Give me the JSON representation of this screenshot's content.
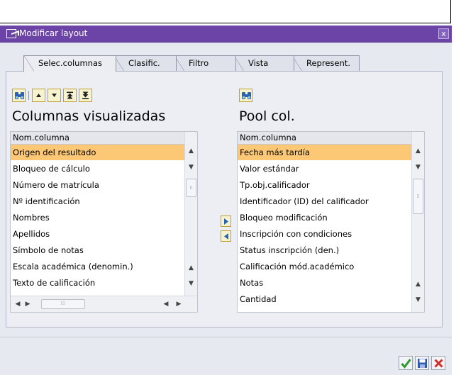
{
  "dialog": {
    "title": "Modificar layout",
    "close_label": "x"
  },
  "tabs": [
    {
      "label": "Selec.columnas",
      "active": true
    },
    {
      "label": "Clasific.",
      "active": false
    },
    {
      "label": "Filtro",
      "active": false
    },
    {
      "label": "Vista",
      "active": false
    },
    {
      "label": "Represent.",
      "active": false
    }
  ],
  "left": {
    "title": "Columnas visualizadas",
    "column_header": "Nom.columna",
    "rows": [
      "Origen del resultado",
      "Bloqueo de cálculo",
      "Número de matrícula",
      "Nº identificación",
      "Nombres",
      "Apellidos",
      "Símbolo de notas",
      "Escala académica (denomin.)",
      "Texto de calificación"
    ],
    "selected_row": 0,
    "toolbar": [
      "find-icon",
      "move-up-icon",
      "move-down-icon",
      "move-top-icon",
      "move-bottom-icon"
    ]
  },
  "right": {
    "title": "Pool col.",
    "column_header": "Nom.columna",
    "rows": [
      "Fecha más tardía",
      "Valor estándar",
      "Tp.obj.calificador",
      "Identificador (ID) del calificador",
      "Bloqueo modificación",
      "Inscripción con condiciones",
      "Status inscripción (den.)",
      "Calificación mód.académico",
      "Notas",
      "Cantidad"
    ],
    "selected_row": 0,
    "toolbar": [
      "find-icon"
    ]
  },
  "colors": {
    "titlebar": "#6c44a8",
    "selection": "#fcc876",
    "button_fill": "#f7f3cf",
    "confirm_green": "#2f9a2f",
    "cancel_red": "#d2302b",
    "save_blue": "#2a5bb8"
  }
}
